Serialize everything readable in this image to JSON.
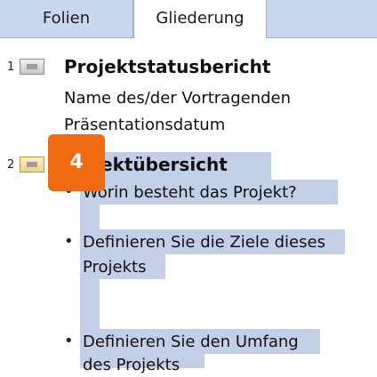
{
  "tabs": {
    "folien": "Folien",
    "gliederung": "Gliederung"
  },
  "slides": [
    {
      "number": "1",
      "title": "Projektstatusbericht",
      "lines": [
        "Name des/der Vortragenden",
        "Präsentationsdatum"
      ]
    },
    {
      "number": "2",
      "title": "ektübersicht",
      "bullets": [
        "Worin besteht das Projekt?",
        "Definieren Sie die Ziele dieses",
        "Projekts",
        "Definieren Sie den Umfang",
        "des Projekts"
      ]
    }
  ],
  "callout": {
    "label": "4",
    "color": "#f06a12"
  },
  "bullet_char": "•"
}
